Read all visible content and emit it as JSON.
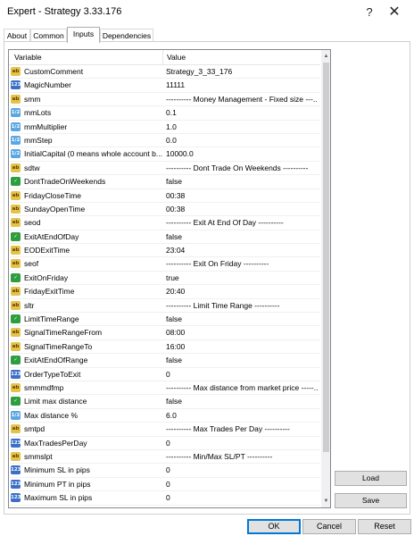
{
  "window": {
    "title": "Expert - Strategy 3.33.176",
    "help_label": "?",
    "close_label": "✕"
  },
  "tabs": [
    {
      "label": "About"
    },
    {
      "label": "Common"
    },
    {
      "label": "Inputs"
    },
    {
      "label": "Dependencies"
    }
  ],
  "active_tab": "Inputs",
  "grid": {
    "headers": {
      "variable": "Variable",
      "value": "Value"
    },
    "rows": [
      {
        "type": "ab",
        "icon": "string-type-icon",
        "name": "CustomComment",
        "value": "Strategy_3_33_176"
      },
      {
        "type": "123",
        "icon": "integer-type-icon",
        "name": "MagicNumber",
        "value": "11111"
      },
      {
        "type": "ab",
        "icon": "string-type-icon",
        "name": "smm",
        "value": "---------- Money Management - Fixed size ---..."
      },
      {
        "type": "1/2",
        "icon": "double-type-icon",
        "name": "mmLots",
        "value": "0.1"
      },
      {
        "type": "1/2",
        "icon": "double-type-icon",
        "name": "mmMultiplier",
        "value": "1.0"
      },
      {
        "type": "1/2",
        "icon": "double-type-icon",
        "name": "mmStep",
        "value": "0.0"
      },
      {
        "type": "1/2",
        "icon": "double-type-icon",
        "name": "InitialCapital (0 means whole account b...",
        "value": "10000.0"
      },
      {
        "type": "ab",
        "icon": "string-type-icon",
        "name": "sdtw",
        "value": "---------- Dont Trade On Weekends ----------"
      },
      {
        "type": "bool",
        "icon": "bool-type-icon",
        "name": "DontTradeOnWeekends",
        "value": "false"
      },
      {
        "type": "ab",
        "icon": "string-type-icon",
        "name": "FridayCloseTime",
        "value": "00:38"
      },
      {
        "type": "ab",
        "icon": "string-type-icon",
        "name": "SundayOpenTime",
        "value": "00:38"
      },
      {
        "type": "ab",
        "icon": "string-type-icon",
        "name": "seod",
        "value": "---------- Exit At End Of Day ----------"
      },
      {
        "type": "bool",
        "icon": "bool-type-icon",
        "name": "ExitAtEndOfDay",
        "value": "false"
      },
      {
        "type": "ab",
        "icon": "string-type-icon",
        "name": "EODExitTime",
        "value": "23:04"
      },
      {
        "type": "ab",
        "icon": "string-type-icon",
        "name": "seof",
        "value": "---------- Exit On Friday ----------"
      },
      {
        "type": "bool",
        "icon": "bool-type-icon",
        "name": "ExitOnFriday",
        "value": "true"
      },
      {
        "type": "ab",
        "icon": "string-type-icon",
        "name": "FridayExitTime",
        "value": "20:40"
      },
      {
        "type": "ab",
        "icon": "string-type-icon",
        "name": "sltr",
        "value": "---------- Limit Time Range ----------"
      },
      {
        "type": "bool",
        "icon": "bool-type-icon",
        "name": "LimitTimeRange",
        "value": "false"
      },
      {
        "type": "ab",
        "icon": "string-type-icon",
        "name": "SignalTimeRangeFrom",
        "value": "08:00"
      },
      {
        "type": "ab",
        "icon": "string-type-icon",
        "name": "SignalTimeRangeTo",
        "value": "16:00"
      },
      {
        "type": "bool",
        "icon": "bool-type-icon",
        "name": "ExitAtEndOfRange",
        "value": "false"
      },
      {
        "type": "123",
        "icon": "integer-type-icon",
        "name": "OrderTypeToExit",
        "value": "0"
      },
      {
        "type": "ab",
        "icon": "string-type-icon",
        "name": "smmmdfmp",
        "value": "---------- Max distance from market price -----..."
      },
      {
        "type": "bool",
        "icon": "bool-type-icon",
        "name": "Limit max distance",
        "value": "false"
      },
      {
        "type": "1/2",
        "icon": "double-type-icon",
        "name": "Max distance %",
        "value": "6.0"
      },
      {
        "type": "ab",
        "icon": "string-type-icon",
        "name": "smtpd",
        "value": "---------- Max Trades Per Day ----------"
      },
      {
        "type": "123",
        "icon": "integer-type-icon",
        "name": "MaxTradesPerDay",
        "value": "0"
      },
      {
        "type": "ab",
        "icon": "string-type-icon",
        "name": "smmslpt",
        "value": "---------- Min/Max SL/PT ----------"
      },
      {
        "type": "123",
        "icon": "integer-type-icon",
        "name": "Minimum SL in pips",
        "value": "0"
      },
      {
        "type": "123",
        "icon": "integer-type-icon",
        "name": "Minimum PT in pips",
        "value": "0"
      },
      {
        "type": "123",
        "icon": "integer-type-icon",
        "name": "Maximum SL in pips",
        "value": "0"
      }
    ]
  },
  "side_buttons": {
    "load": "Load",
    "save": "Save"
  },
  "footer_buttons": {
    "ok": "OK",
    "cancel": "Cancel",
    "reset": "Reset"
  },
  "colors": {
    "string_icon": "#e5c349",
    "integer_icon": "#3b6fc6",
    "double_icon": "#5aa6e0",
    "bool_icon": "#2c9e3e",
    "accent": "#0078d7"
  }
}
